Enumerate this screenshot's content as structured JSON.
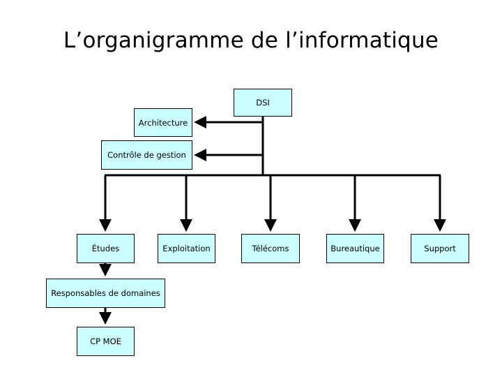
{
  "title": "L’organigramme de l’informatique",
  "colors": {
    "box_fill": "#ccffff",
    "line": "#000000"
  },
  "nodes": {
    "dsi": "DSI",
    "architecture": "Architecture",
    "controle": "Contrôle de gestion",
    "etudes": "Études",
    "exploitation": "Exploitation",
    "telecoms": "Télécoms",
    "bureautique": "Bureautique",
    "support": "Support",
    "responsables": "Responsables de domaines",
    "cpmoe": "CP MOE"
  },
  "edges": [
    [
      "dsi",
      "architecture"
    ],
    [
      "dsi",
      "controle"
    ],
    [
      "dsi",
      "etudes"
    ],
    [
      "dsi",
      "exploitation"
    ],
    [
      "dsi",
      "telecoms"
    ],
    [
      "dsi",
      "bureautique"
    ],
    [
      "dsi",
      "support"
    ],
    [
      "etudes",
      "responsables"
    ],
    [
      "responsables",
      "cpmoe"
    ]
  ]
}
